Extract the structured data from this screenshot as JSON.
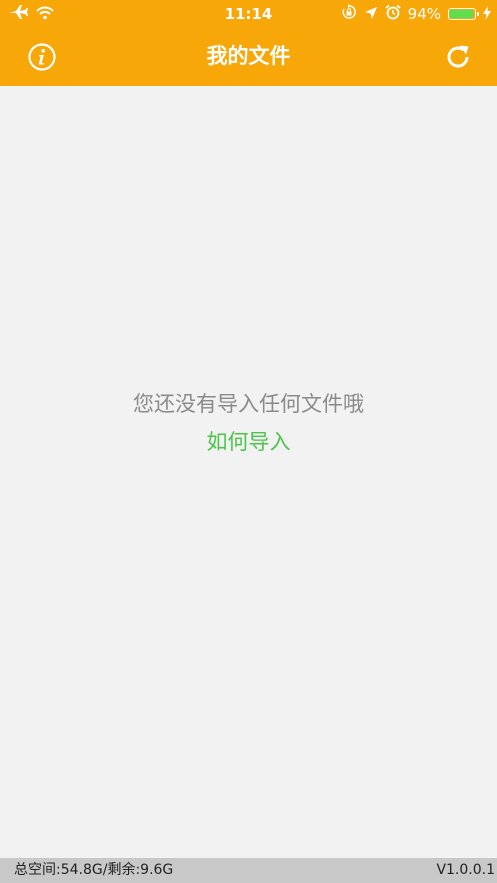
{
  "status_bar": {
    "time": "11:14",
    "battery_percent": "94%",
    "battery_level": 0.94,
    "icons": [
      "airplane-icon",
      "wifi-icon",
      "orientation-lock-icon",
      "location-arrow-icon",
      "alarm-icon",
      "charging-bolt-icon"
    ]
  },
  "nav": {
    "title": "我的文件",
    "left_icon": "info-icon",
    "right_icon": "refresh-icon"
  },
  "main": {
    "empty_message": "您还没有导入任何文件哦",
    "import_link": "如何导入"
  },
  "footer": {
    "storage": "总空间:54.8G/剩余:9.6G",
    "version": "V1.0.0.1"
  },
  "colors": {
    "header_bg": "#f7a707",
    "content_bg": "#f2f2f2",
    "link_green": "#4cc44c",
    "message_gray": "#8a8a8a",
    "footer_bg": "#c8c8c8",
    "battery_green": "#5fe04a"
  }
}
